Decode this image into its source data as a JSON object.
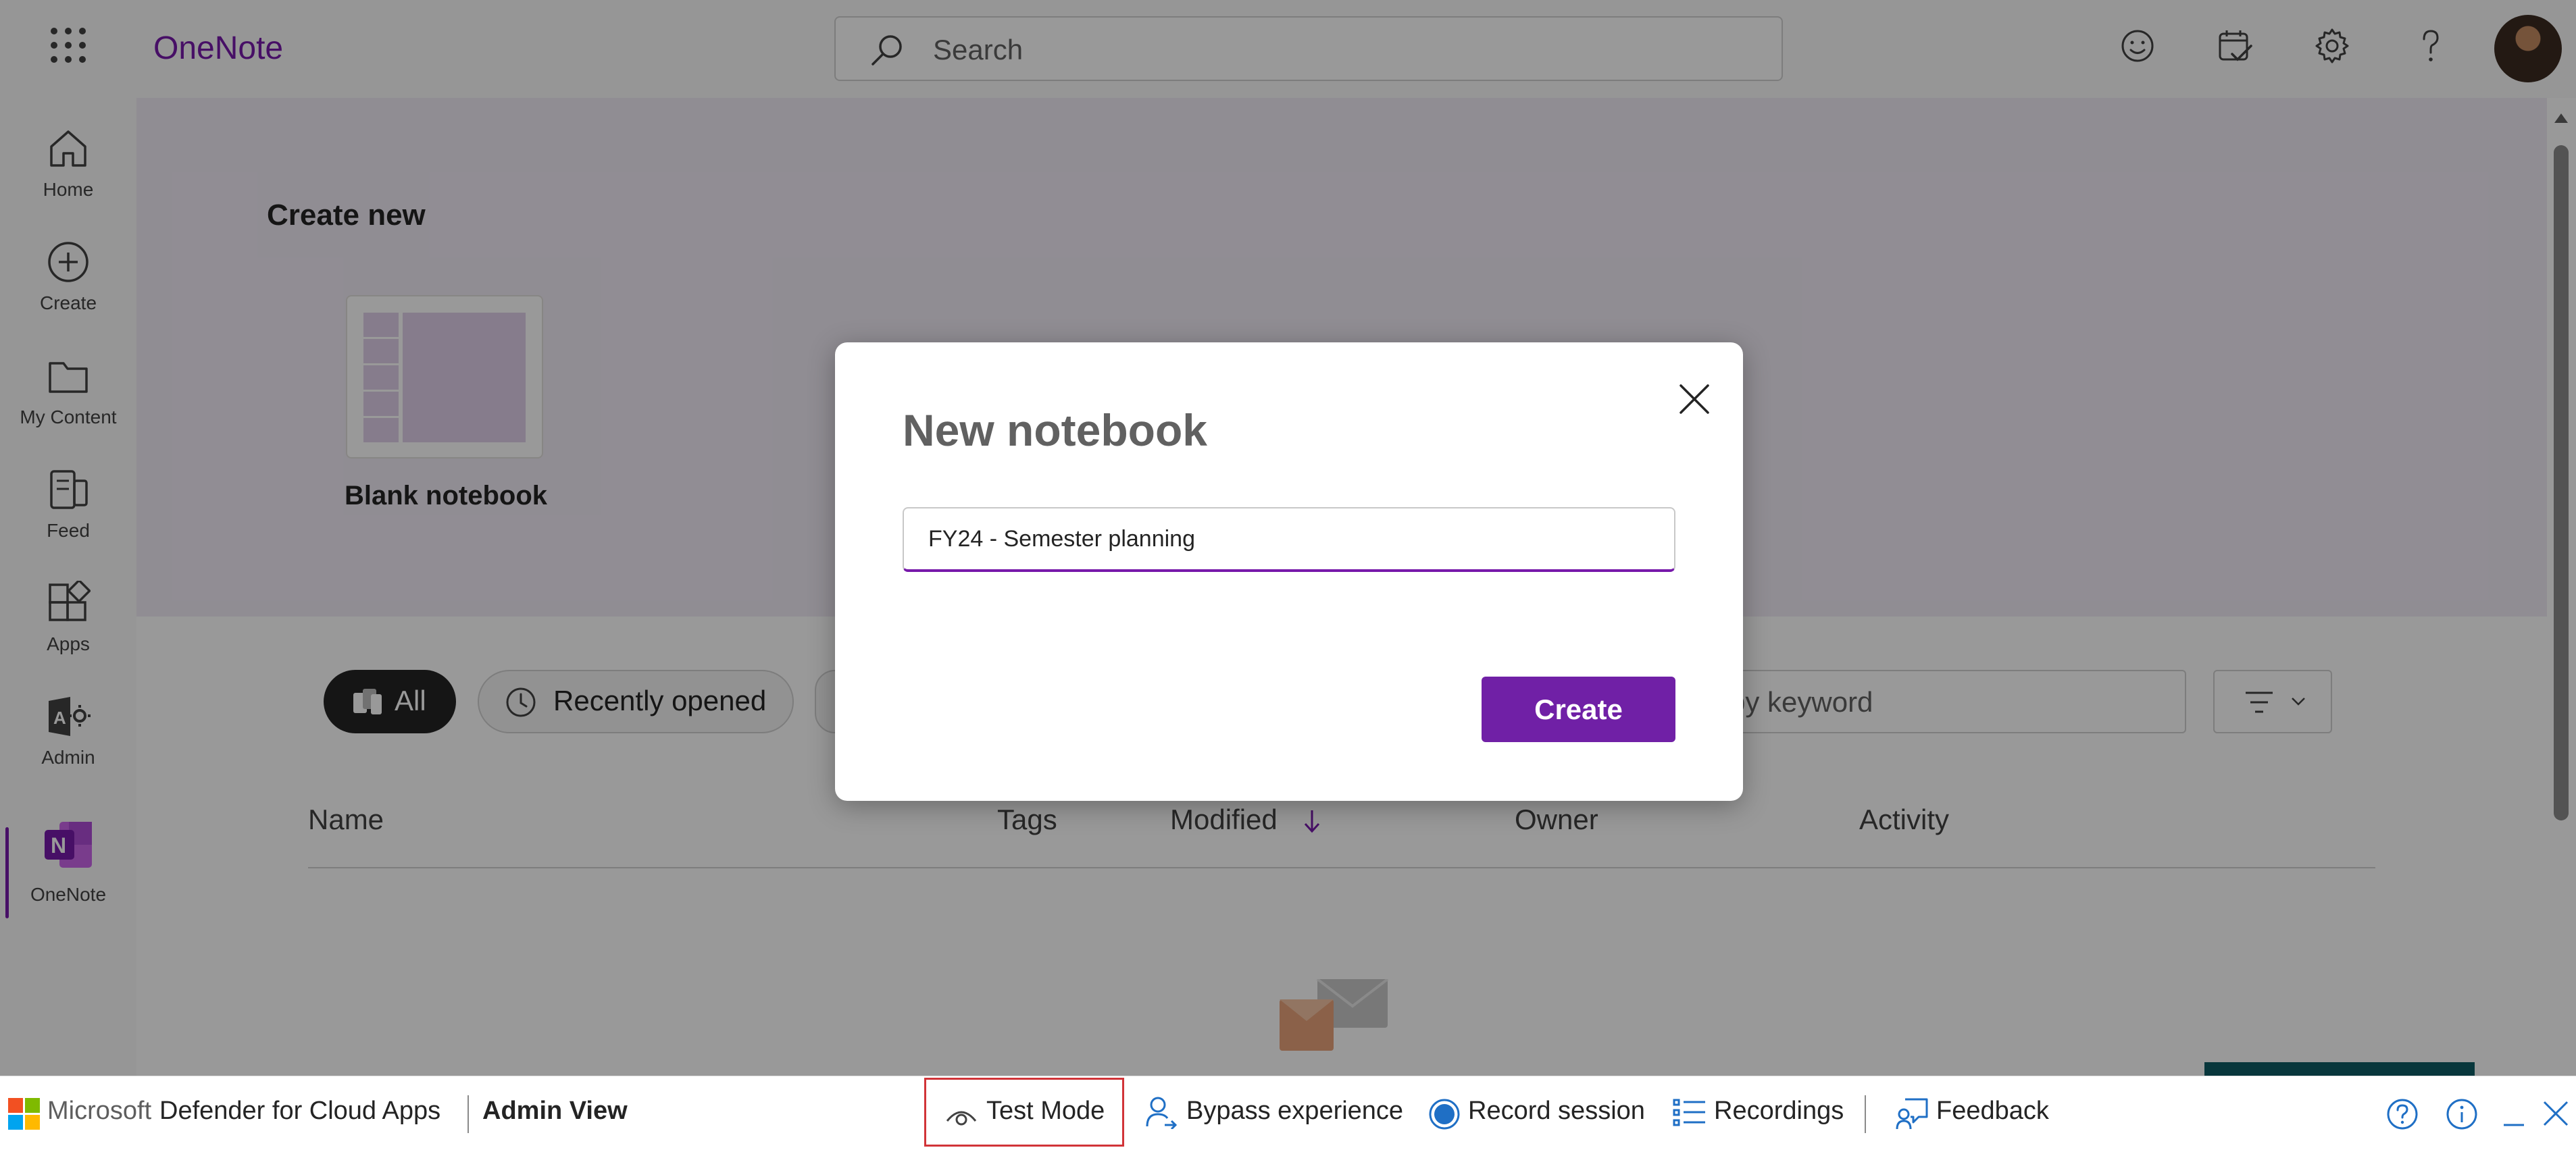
{
  "app": {
    "name": "OneNote"
  },
  "search": {
    "placeholder": "Search"
  },
  "rail": {
    "items": [
      {
        "label": "Home",
        "icon": "home-icon"
      },
      {
        "label": "Create",
        "icon": "plus-circle-icon"
      },
      {
        "label": "My Content",
        "icon": "folder-icon"
      },
      {
        "label": "Feed",
        "icon": "feed-icon"
      },
      {
        "label": "Apps",
        "icon": "apps-icon"
      },
      {
        "label": "Admin",
        "icon": "admin-icon"
      },
      {
        "label": "OneNote",
        "icon": "onenote-icon"
      }
    ]
  },
  "hero": {
    "title": "Create new",
    "card_label": "Blank notebook"
  },
  "filters": {
    "all": "All",
    "recent": "Recently opened",
    "keyword_placeholder": "by keyword"
  },
  "table": {
    "columns": [
      "Name",
      "Tags",
      "Modified",
      "Owner",
      "Activity"
    ]
  },
  "dialog": {
    "title": "New notebook",
    "input_value": "FY24 - Semester planning",
    "create_label": "Create"
  },
  "bottom_bar": {
    "microsoft": "Microsoft",
    "product": "Defender for Cloud Apps",
    "admin_view": "Admin View",
    "test_mode": "Test Mode",
    "bypass": "Bypass experience",
    "record": "Record session",
    "recordings": "Recordings",
    "feedback": "Feedback"
  },
  "colors": {
    "brand": "#7719aa",
    "create_button": "#7020a6",
    "highlight": "#d13438"
  }
}
